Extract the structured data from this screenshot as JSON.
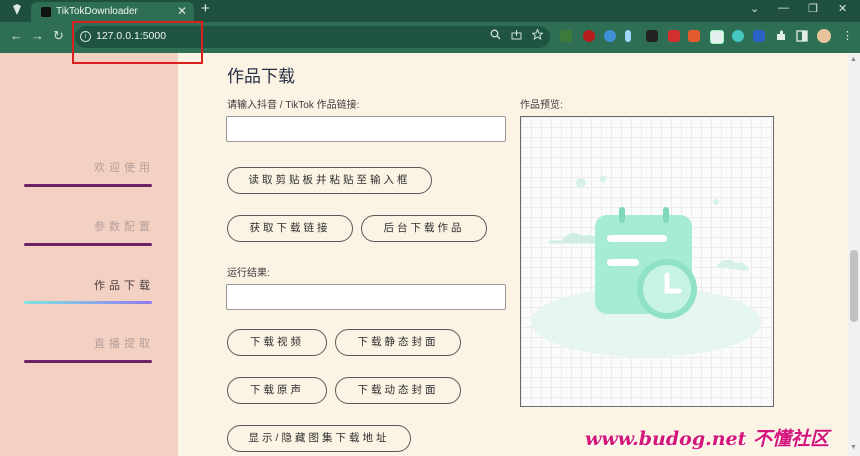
{
  "browser": {
    "tab_title": "TikTokDownloader",
    "tab_close": "✕",
    "new_tab": "+",
    "url": "127.0.0.1:5000",
    "nav": {
      "back": "←",
      "forward": "→",
      "reload": "↻"
    },
    "window_controls": [
      "⌄",
      "—",
      "❐",
      "✕"
    ],
    "highlight_color": "#d9201e"
  },
  "sidebar": {
    "items": [
      {
        "label": "欢迎使用",
        "active": false
      },
      {
        "label": "参数配置",
        "active": false
      },
      {
        "label": "作品下载",
        "active": true
      },
      {
        "label": "直播提取",
        "active": false
      }
    ]
  },
  "main": {
    "title": "作品下载",
    "link_label": "请输入抖音 / TikTok 作品链接:",
    "link_value": "",
    "preview_label": "作品预览:",
    "result_label": "运行结果:",
    "result_value": "",
    "buttons": {
      "paste": "读取剪贴板并粘贴至输入框",
      "get_link": "获取下载链接",
      "bg_download": "后台下载作品",
      "download_video": "下载视频",
      "download_static_cover": "下载静态封面",
      "download_audio": "下载原声",
      "download_dynamic_cover": "下载动态封面",
      "toggle_gallery": "显示/隐藏图集下载地址"
    }
  },
  "watermark": "www.budog.net 不懂社区",
  "colors": {
    "sidebar_bg": "#f2d1c2",
    "page_bg": "#fbf3e4",
    "nav_line": "#6c2466",
    "chrome": "#2e6e55"
  }
}
